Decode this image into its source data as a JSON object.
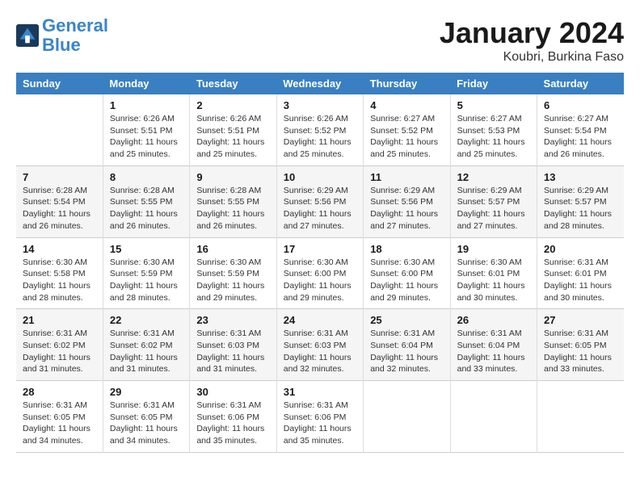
{
  "header": {
    "logo_line1": "General",
    "logo_line2": "Blue",
    "title": "January 2024",
    "subtitle": "Koubri, Burkina Faso"
  },
  "calendar": {
    "days_of_week": [
      "Sunday",
      "Monday",
      "Tuesday",
      "Wednesday",
      "Thursday",
      "Friday",
      "Saturday"
    ],
    "weeks": [
      [
        {
          "num": "",
          "info": ""
        },
        {
          "num": "1",
          "info": "Sunrise: 6:26 AM\nSunset: 5:51 PM\nDaylight: 11 hours\nand 25 minutes."
        },
        {
          "num": "2",
          "info": "Sunrise: 6:26 AM\nSunset: 5:51 PM\nDaylight: 11 hours\nand 25 minutes."
        },
        {
          "num": "3",
          "info": "Sunrise: 6:26 AM\nSunset: 5:52 PM\nDaylight: 11 hours\nand 25 minutes."
        },
        {
          "num": "4",
          "info": "Sunrise: 6:27 AM\nSunset: 5:52 PM\nDaylight: 11 hours\nand 25 minutes."
        },
        {
          "num": "5",
          "info": "Sunrise: 6:27 AM\nSunset: 5:53 PM\nDaylight: 11 hours\nand 25 minutes."
        },
        {
          "num": "6",
          "info": "Sunrise: 6:27 AM\nSunset: 5:54 PM\nDaylight: 11 hours\nand 26 minutes."
        }
      ],
      [
        {
          "num": "7",
          "info": "Sunrise: 6:28 AM\nSunset: 5:54 PM\nDaylight: 11 hours\nand 26 minutes."
        },
        {
          "num": "8",
          "info": "Sunrise: 6:28 AM\nSunset: 5:55 PM\nDaylight: 11 hours\nand 26 minutes."
        },
        {
          "num": "9",
          "info": "Sunrise: 6:28 AM\nSunset: 5:55 PM\nDaylight: 11 hours\nand 26 minutes."
        },
        {
          "num": "10",
          "info": "Sunrise: 6:29 AM\nSunset: 5:56 PM\nDaylight: 11 hours\nand 27 minutes."
        },
        {
          "num": "11",
          "info": "Sunrise: 6:29 AM\nSunset: 5:56 PM\nDaylight: 11 hours\nand 27 minutes."
        },
        {
          "num": "12",
          "info": "Sunrise: 6:29 AM\nSunset: 5:57 PM\nDaylight: 11 hours\nand 27 minutes."
        },
        {
          "num": "13",
          "info": "Sunrise: 6:29 AM\nSunset: 5:57 PM\nDaylight: 11 hours\nand 28 minutes."
        }
      ],
      [
        {
          "num": "14",
          "info": "Sunrise: 6:30 AM\nSunset: 5:58 PM\nDaylight: 11 hours\nand 28 minutes."
        },
        {
          "num": "15",
          "info": "Sunrise: 6:30 AM\nSunset: 5:59 PM\nDaylight: 11 hours\nand 28 minutes."
        },
        {
          "num": "16",
          "info": "Sunrise: 6:30 AM\nSunset: 5:59 PM\nDaylight: 11 hours\nand 29 minutes."
        },
        {
          "num": "17",
          "info": "Sunrise: 6:30 AM\nSunset: 6:00 PM\nDaylight: 11 hours\nand 29 minutes."
        },
        {
          "num": "18",
          "info": "Sunrise: 6:30 AM\nSunset: 6:00 PM\nDaylight: 11 hours\nand 29 minutes."
        },
        {
          "num": "19",
          "info": "Sunrise: 6:30 AM\nSunset: 6:01 PM\nDaylight: 11 hours\nand 30 minutes."
        },
        {
          "num": "20",
          "info": "Sunrise: 6:31 AM\nSunset: 6:01 PM\nDaylight: 11 hours\nand 30 minutes."
        }
      ],
      [
        {
          "num": "21",
          "info": "Sunrise: 6:31 AM\nSunset: 6:02 PM\nDaylight: 11 hours\nand 31 minutes."
        },
        {
          "num": "22",
          "info": "Sunrise: 6:31 AM\nSunset: 6:02 PM\nDaylight: 11 hours\nand 31 minutes."
        },
        {
          "num": "23",
          "info": "Sunrise: 6:31 AM\nSunset: 6:03 PM\nDaylight: 11 hours\nand 31 minutes."
        },
        {
          "num": "24",
          "info": "Sunrise: 6:31 AM\nSunset: 6:03 PM\nDaylight: 11 hours\nand 32 minutes."
        },
        {
          "num": "25",
          "info": "Sunrise: 6:31 AM\nSunset: 6:04 PM\nDaylight: 11 hours\nand 32 minutes."
        },
        {
          "num": "26",
          "info": "Sunrise: 6:31 AM\nSunset: 6:04 PM\nDaylight: 11 hours\nand 33 minutes."
        },
        {
          "num": "27",
          "info": "Sunrise: 6:31 AM\nSunset: 6:05 PM\nDaylight: 11 hours\nand 33 minutes."
        }
      ],
      [
        {
          "num": "28",
          "info": "Sunrise: 6:31 AM\nSunset: 6:05 PM\nDaylight: 11 hours\nand 34 minutes."
        },
        {
          "num": "29",
          "info": "Sunrise: 6:31 AM\nSunset: 6:05 PM\nDaylight: 11 hours\nand 34 minutes."
        },
        {
          "num": "30",
          "info": "Sunrise: 6:31 AM\nSunset: 6:06 PM\nDaylight: 11 hours\nand 35 minutes."
        },
        {
          "num": "31",
          "info": "Sunrise: 6:31 AM\nSunset: 6:06 PM\nDaylight: 11 hours\nand 35 minutes."
        },
        {
          "num": "",
          "info": ""
        },
        {
          "num": "",
          "info": ""
        },
        {
          "num": "",
          "info": ""
        }
      ]
    ]
  }
}
